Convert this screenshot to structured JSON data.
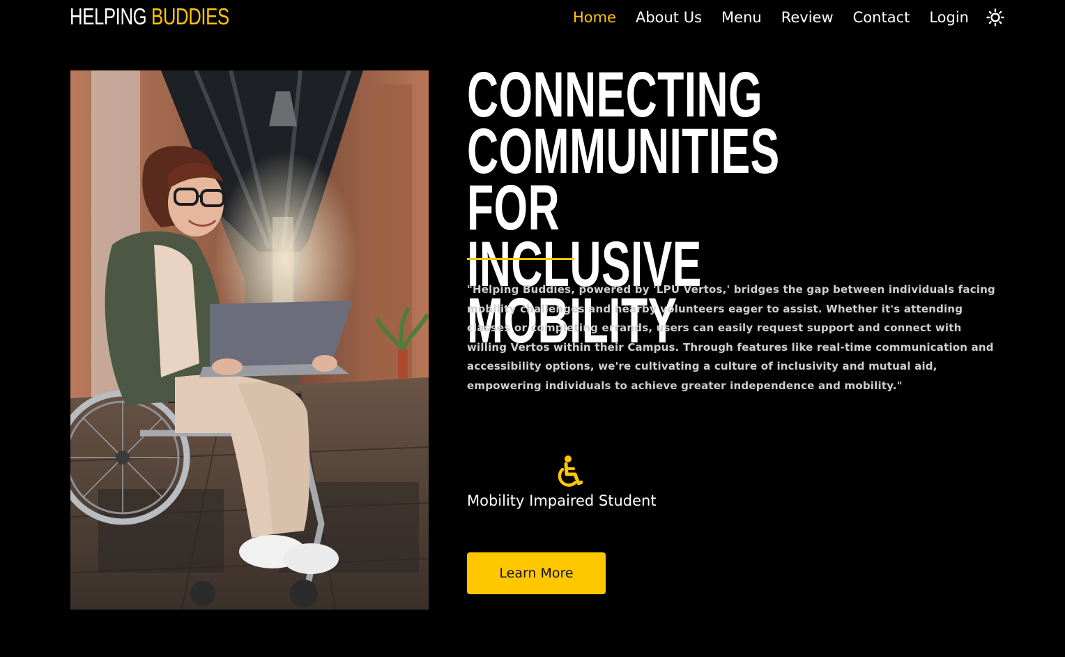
{
  "brand": {
    "name_part1": "HELPING",
    "name_part2": "BUDDIES",
    "accent_color": "#ffc700"
  },
  "nav": {
    "items": [
      {
        "label": "Home",
        "active": true
      },
      {
        "label": "About Us",
        "active": false
      },
      {
        "label": "Menu",
        "active": false
      },
      {
        "label": "Review",
        "active": false
      },
      {
        "label": "Contact",
        "active": false
      },
      {
        "label": "Login",
        "active": false
      }
    ],
    "theme_toggle_icon": "sun-icon"
  },
  "hero": {
    "image_icon": "woman-in-wheelchair-with-laptop-photo",
    "title": "CONNECTING\nCOMMUNITIES FOR\nINCLUSIVE MOBILITY",
    "description": "\"Helping Buddies, powered by 'LPU Vertos,' bridges the gap between individuals facing mobility challenges and nearby volunteers eager to assist. Whether it's attending classes or completing errands, users can easily request support and connect with willing Vertos within their Campus. Through features like real-time communication and accessibility options, we're cultivating a culture of inclusivity and mutual aid, empowering individuals to achieve greater independence and mobility.\"",
    "feature": {
      "icon": "wheelchair-icon",
      "label": "Mobility Impaired Student"
    },
    "cta_label": "Learn More"
  },
  "colors": {
    "background": "#000000",
    "text": "#ffffff",
    "accent": "#ffc700",
    "body_text": "#cfcfcf"
  }
}
